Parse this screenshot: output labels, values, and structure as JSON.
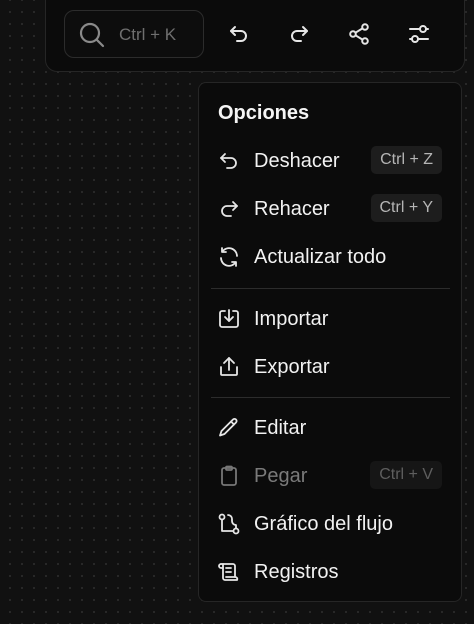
{
  "toolbar": {
    "search": {
      "placeholder": "Ctrl + K",
      "icon": "search-icon"
    },
    "buttons": [
      {
        "name": "undo-button",
        "icon": "undo-icon"
      },
      {
        "name": "redo-button",
        "icon": "redo-icon"
      },
      {
        "name": "share-button",
        "icon": "share-icon"
      },
      {
        "name": "options-button",
        "icon": "settings-sliders-icon"
      }
    ]
  },
  "menu": {
    "title": "Opciones",
    "items": [
      {
        "label": "Deshacer",
        "shortcut": "Ctrl + Z",
        "icon": "undo-icon",
        "enabled": true
      },
      {
        "label": "Rehacer",
        "shortcut": "Ctrl + Y",
        "icon": "redo-icon",
        "enabled": true
      },
      {
        "label": "Actualizar todo",
        "shortcut": "",
        "icon": "refresh-icon",
        "enabled": true
      },
      {
        "label": "Importar",
        "shortcut": "",
        "icon": "import-icon",
        "enabled": true
      },
      {
        "label": "Exportar",
        "shortcut": "",
        "icon": "export-icon",
        "enabled": true
      },
      {
        "label": "Editar",
        "shortcut": "",
        "icon": "pencil-icon",
        "enabled": true
      },
      {
        "label": "Pegar",
        "shortcut": "Ctrl + V",
        "icon": "clipboard-icon",
        "enabled": false
      },
      {
        "label": "Gráfico del flujo",
        "shortcut": "",
        "icon": "flow-graph-icon",
        "enabled": true
      },
      {
        "label": "Registros",
        "shortcut": "",
        "icon": "logs-scroll-icon",
        "enabled": true
      }
    ]
  },
  "colors": {
    "background": "#111111",
    "panel": "#0b0b0b",
    "border": "#262626",
    "text": "#f2f2f2",
    "muted": "#6f6f6f",
    "kbd_bg": "#1d1d1d"
  }
}
